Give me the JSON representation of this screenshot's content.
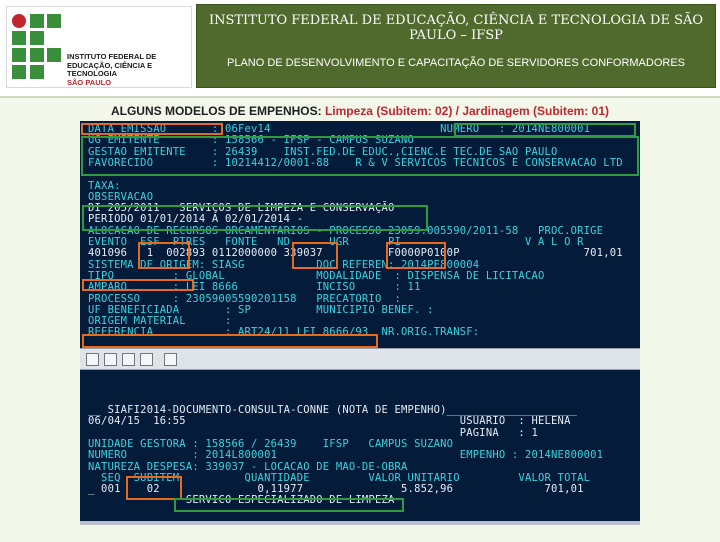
{
  "logo": {
    "lines": [
      "INSTITUTO FEDERAL DE",
      "EDUCAÇÃO, CIÊNCIA E TECNOLOGIA",
      "SÃO PAULO"
    ],
    "colors": {
      "green": "#3a8f3d",
      "red": "#c0262d"
    }
  },
  "header": {
    "title": "INSTITUTO FEDERAL DE EDUCAÇÃO, CIÊNCIA E TECNOLOGIA DE SÃO PAULO – IFSP",
    "subtitle": "PLANO DE DESENVOLVIMENTO E CAPACITAÇÃO DE SERVIDORES CONFORMADORES",
    "bg_color": "#4f6a2c"
  },
  "slide": {
    "caption_prefix": "ALGUNS MODELOS DE EMPENHOS: ",
    "caption_highlight": "Limpeza (Subitem: 02) / Jardinagem (Subitem: 01)"
  },
  "terminal_top": {
    "lines": [
      {
        "text": "DATA EMISSAO       : 06Fev14                          NUMERO   : 2014NE800001",
        "color": "cyan"
      },
      {
        "text": "UG EMITENTE        : 158566 - IFSP - CAMPUS SUZANO",
        "color": "cyan"
      },
      {
        "text": "GESTAO EMITENTE    : 26439    INST.FED.DE EDUC.,CIENC.E TEC.DE SAO PAULO",
        "color": "cyan"
      },
      {
        "text": "FAVORECIDO         : 10214412/0001-88    R & V SERVICOS TECNICOS E CONSERVACAO LTD",
        "color": "cyan"
      },
      {
        "text": "",
        "color": "white"
      },
      {
        "text": "TAXA:",
        "color": "cyan"
      },
      {
        "text": "OBSERVACAO",
        "color": "cyan"
      },
      {
        "text": "DI 205/2011   SERVIÇOS DE LIMPEZA E CONSERVAÇÃO",
        "color": "white"
      },
      {
        "text": "PERIODO 01/01/2014 A 02/01/2014 -",
        "color": "white"
      },
      {
        "text": "ALOCACAO DE RECURSOS ORCAMENTARIOS - PROCESSO 23059.005590/2011-58   PROC.ORIGE",
        "color": "cyan"
      },
      {
        "text": "EVENTO  ESF  PTRES   FONTE   ND      UGR      PI                   V A L O R",
        "color": "cyan"
      },
      {
        "text": "401096   1  002893 0112000000 339037          F0000P0100P                   701,01",
        "color": "white"
      },
      {
        "text": "SISTEMA DE ORIGEM: SIASG           DOC REFEREN: 2014PE800004",
        "color": "cyan"
      },
      {
        "text": "TIPO         : GLOBAL              MODALIDADE  : DISPENSA DE LICITACAO",
        "color": "cyan"
      },
      {
        "text": "AMPARO       : LEI 8666            INCISO      : 11",
        "color": "cyan"
      },
      {
        "text": "PROCESSO     : 23059005590201158   PRECATORIO  :",
        "color": "cyan"
      },
      {
        "text": "UF BENEFICIADA       : SP          MUNICIPIO BENEF. :",
        "color": "cyan"
      },
      {
        "text": "ORIGEM MATERIAL      :",
        "color": "cyan"
      },
      {
        "text": "REFERENCIA           : ART24/11 LEI 8666/93  NR.ORIG.TRANSF:",
        "color": "cyan"
      }
    ]
  },
  "terminal_bottom": {
    "lines": [
      {
        "text": "__ SIAFI2014-DOCUMENTO-CONSULTA-CONNE (NOTA DE EMPENHO)____________________",
        "color": "white"
      },
      {
        "text": "06/04/15  16:55                                          USUARIO  : HELENA",
        "color": "white"
      },
      {
        "text": "                                                         PAGINA   : 1",
        "color": "white"
      },
      {
        "text": "UNIDADE GESTORA : 158566 / 26439    IFSP   CAMPUS SUZANO",
        "color": "cyan"
      },
      {
        "text": "NUMERO          : 2014L800001                            EMPENHO : 2014NE800001",
        "color": "cyan"
      },
      {
        "text": "NATUREZA DESPESA: 339037 - LOCACAO DE MAO-DE-OBRA",
        "color": "cyan"
      },
      {
        "text": "  SEQ  SUBITEM          QUANTIDADE         VALOR UNITARIO         VALOR TOTAL",
        "color": "cyan"
      },
      {
        "text": "_ 001    02               0,11977               5.852,96              701,01",
        "color": "white"
      },
      {
        "text": "               SERVICO ESPECIALIZADO DE LIMPEZA",
        "color": "white"
      }
    ]
  },
  "highlight_colors": {
    "green": "#2e9b3e",
    "orange": "#e86a1c"
  }
}
